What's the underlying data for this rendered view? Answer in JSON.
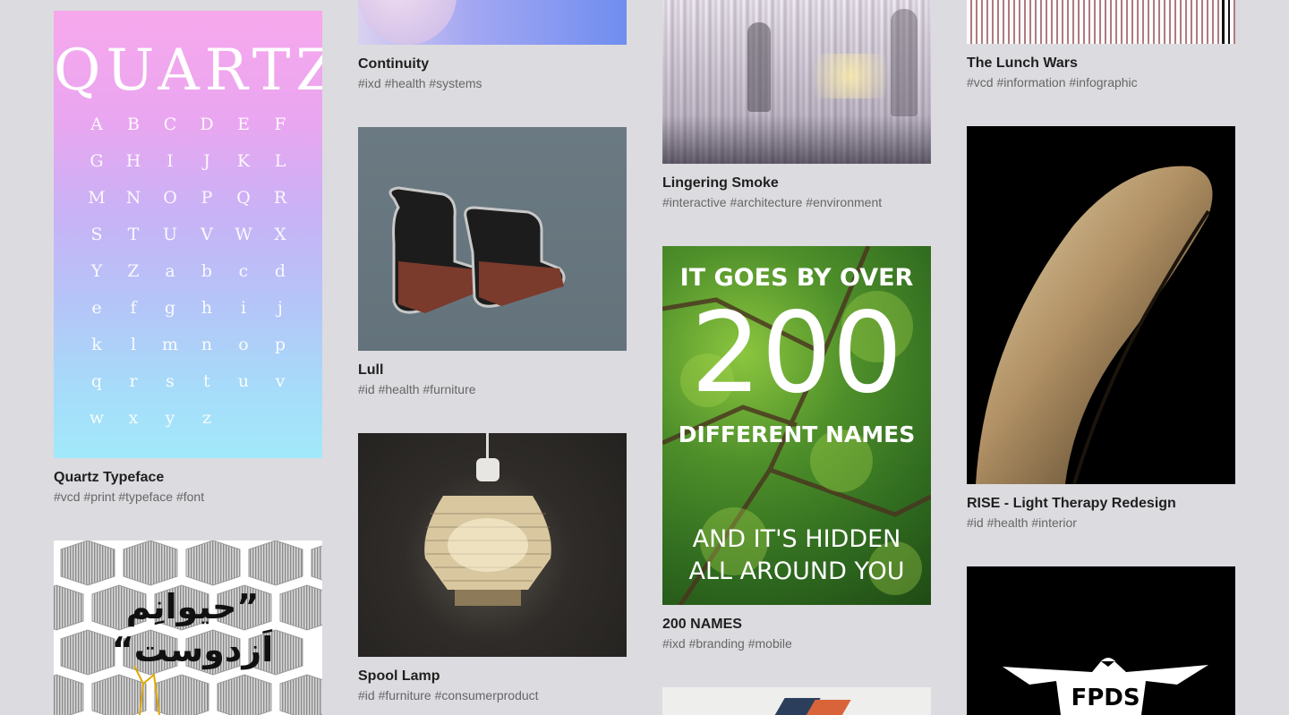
{
  "projects": [
    {
      "title": "Quartz Typeface",
      "tags": "#vcd #print #typeface #font"
    },
    {
      "title": "Continuity",
      "tags": "#ixd #health #systems"
    },
    {
      "title": "Lull",
      "tags": "#id #health #furniture"
    },
    {
      "title": "Spool Lamp",
      "tags": "#id #furniture #consumerproduct"
    },
    {
      "title": "Lingering Smoke",
      "tags": "#interactive #architecture #environment"
    },
    {
      "title": "200 NAMES",
      "tags": "#ixd #branding #mobile"
    },
    {
      "title": "The Lunch Wars",
      "tags": "#vcd #information #infographic"
    },
    {
      "title": "RISE - Light Therapy Redesign",
      "tags": "#id #health #interior"
    }
  ],
  "quartz_poster": {
    "heading": "QUARTZ",
    "rows": [
      [
        "A",
        "B",
        "C",
        "D",
        "E",
        "F"
      ],
      [
        "G",
        "H",
        "I",
        "J",
        "K",
        "L"
      ],
      [
        "M",
        "N",
        "O",
        "P",
        "Q",
        "R"
      ],
      [
        "S",
        "T",
        "U",
        "V",
        "W",
        "X"
      ],
      [
        "Y",
        "Z",
        "a",
        "b",
        "c",
        "d"
      ],
      [
        "e",
        "f",
        "g",
        "h",
        "i",
        "j"
      ],
      [
        "k",
        "l",
        "m",
        "n",
        "o",
        "p"
      ],
      [
        "q",
        "r",
        "s",
        "t",
        "u",
        "v"
      ],
      [
        "w",
        "x",
        "y",
        "z"
      ]
    ]
  },
  "names_poster": {
    "line1": "IT GOES BY OVER",
    "number": "200",
    "line2": "DIFFERENT NAMES",
    "line3": "AND IT'S HIDDEN",
    "line4": "ALL AROUND YOU"
  },
  "persian_poster": {
    "text": "”حیوانِم اَزدوست“"
  },
  "fpds_logo": {
    "text": "FPDS"
  }
}
